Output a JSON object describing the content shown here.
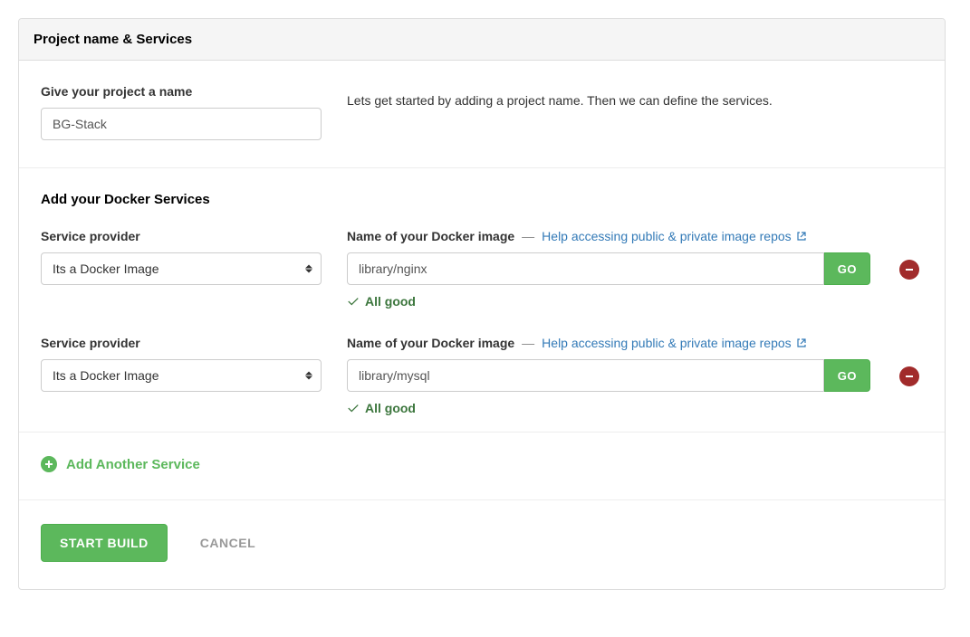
{
  "panel": {
    "title": "Project name & Services"
  },
  "project": {
    "name_label": "Give your project a name",
    "name_value": "BG-Stack",
    "hint": "Lets get started by adding a project name. Then we can define the services."
  },
  "services": {
    "heading": "Add your Docker Services",
    "provider_label": "Service provider",
    "image_label": "Name of your Docker image",
    "help_link_text": "Help accessing public & private image repos",
    "go_label": "GO",
    "status_ok": "All good",
    "provider_option": "Its a Docker Image",
    "items": [
      {
        "provider": "Its a Docker Image",
        "image": "library/nginx",
        "status": "ok"
      },
      {
        "provider": "Its a Docker Image",
        "image": "library/mysql",
        "status": "ok"
      }
    ]
  },
  "actions": {
    "add_another": "Add Another Service",
    "start_build": "START BUILD",
    "cancel": "CANCEL"
  }
}
